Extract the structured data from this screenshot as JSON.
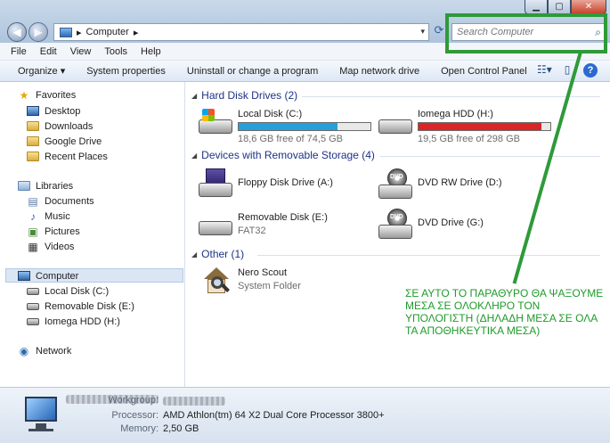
{
  "window": {
    "controls": {
      "minimize": "▁",
      "maximize": "▢",
      "close": "✕"
    }
  },
  "nav": {
    "back": "◀",
    "forward": "▶"
  },
  "address": {
    "path_sep": "▸",
    "location": "Computer",
    "trailing_sep": "▸",
    "dropdown": "▾"
  },
  "search": {
    "placeholder": "Search Computer"
  },
  "menu": [
    "File",
    "Edit",
    "View",
    "Tools",
    "Help"
  ],
  "toolbar": {
    "items": [
      "Organize ▾",
      "System properties",
      "Uninstall or change a program",
      "Map network drive",
      "Open Control Panel"
    ]
  },
  "sidebar": {
    "favorites_label": "Favorites",
    "favorites": [
      "Desktop",
      "Downloads",
      "Google Drive",
      "Recent Places"
    ],
    "libraries_label": "Libraries",
    "libraries": [
      "Documents",
      "Music",
      "Pictures",
      "Videos"
    ],
    "computer_label": "Computer",
    "computer": [
      "Local Disk (C:)",
      "Removable Disk (E:)",
      "Iomega HDD (H:)"
    ],
    "network_label": "Network"
  },
  "content": {
    "hdd_header": "Hard Disk Drives (2)",
    "removable_header": "Devices with Removable Storage (4)",
    "other_header": "Other (1)",
    "drives": [
      {
        "name": "Local Disk (C:)",
        "free": "18,6 GB free of 74,5 GB",
        "used_fraction": 0.75,
        "bar_color": "#26a0da"
      },
      {
        "name": "Iomega HDD (H:)",
        "free": "19,5 GB free of 298 GB",
        "used_fraction": 0.93,
        "bar_color": "#da2626"
      }
    ],
    "removable": [
      {
        "name": "Floppy Disk Drive (A:)"
      },
      {
        "name": "DVD RW Drive (D:)",
        "label": "DVD"
      },
      {
        "name": "Removable Disk (E:)",
        "sub": "FAT32"
      },
      {
        "name": "DVD Drive (G:)",
        "label": "DVD"
      }
    ],
    "other": [
      {
        "name": "Nero Scout",
        "sub": "System Folder"
      }
    ]
  },
  "annotation": "ΣΕ ΑΥΤΟ ΤΟ ΠΑΡΑΘΥΡΟ ΘΑ ΨΑΞΟΥΜΕ ΜΕΣΑ ΣΕ ΟΛΟΚΛΗΡΟ ΤΟΝ ΥΠΟΛΟΓΙΣΤΗ (ΔΗΛΑΔΗ ΜΕΣΑ ΣΕ ΟΛΑ ΤΑ ΑΠΟΘΗΚΕΥΤΙΚΑ ΜΕΣΑ)",
  "details": {
    "workgroup_label": "Workgroup:",
    "processor_label": "Processor:",
    "processor": "AMD Athlon(tm) 64 X2 Dual Core Processor 3800+",
    "memory_label": "Memory:",
    "memory": "2,50 GB"
  },
  "colors": {
    "annotation": "#2e9a3a",
    "group_header": "#1e3287"
  }
}
